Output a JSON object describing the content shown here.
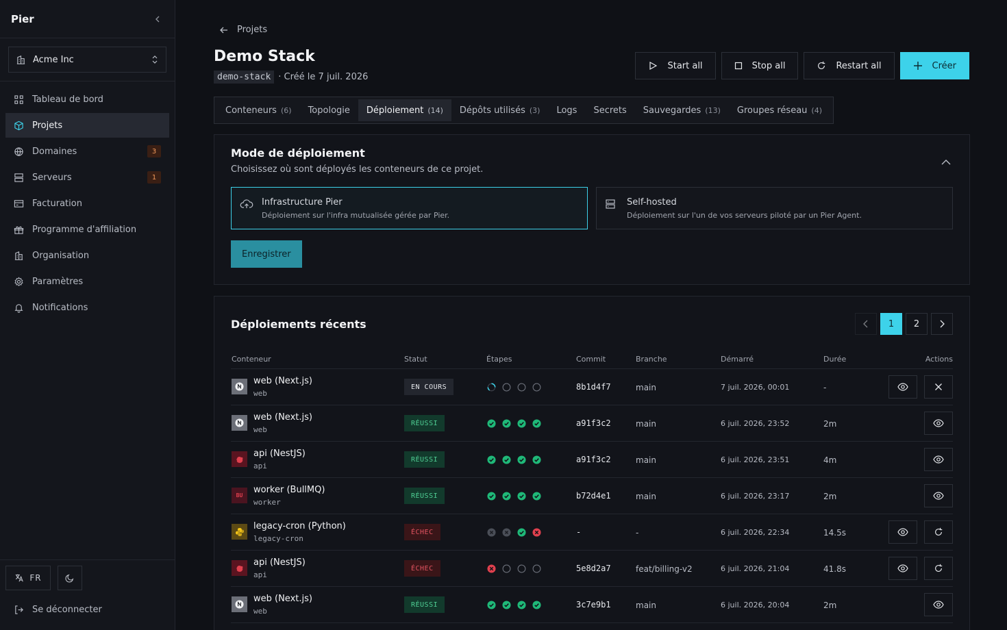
{
  "sidebar": {
    "brand": "Pier",
    "org": "Acme Inc",
    "items": [
      {
        "label": "Tableau de bord",
        "icon": "grid-icon",
        "badge": ""
      },
      {
        "label": "Projets",
        "icon": "cube-icon",
        "badge": "",
        "active": true
      },
      {
        "label": "Domaines",
        "icon": "globe-icon",
        "badge": "3"
      },
      {
        "label": "Serveurs",
        "icon": "server-icon",
        "badge": "1"
      },
      {
        "label": "Facturation",
        "icon": "credit-card-icon",
        "badge": ""
      },
      {
        "label": "Programme d'affiliation",
        "icon": "gift-icon",
        "badge": ""
      },
      {
        "label": "Organisation",
        "icon": "building-icon",
        "badge": ""
      },
      {
        "label": "Paramètres",
        "icon": "gear-icon",
        "badge": ""
      },
      {
        "label": "Notifications",
        "icon": "bell-icon",
        "badge": ""
      }
    ],
    "lang": "FR",
    "logout": "Se déconnecter"
  },
  "header": {
    "back": "Projets",
    "title": "Demo Stack",
    "slug": "demo-stack",
    "created": "· Créé le 7 juil. 2026",
    "actions": {
      "start": "Start all",
      "stop": "Stop all",
      "restart": "Restart all",
      "create": "Créer"
    }
  },
  "tabs": [
    {
      "label": "Conteneurs",
      "count": "(6)"
    },
    {
      "label": "Topologie",
      "count": ""
    },
    {
      "label": "Déploiement",
      "count": "(14)",
      "active": true
    },
    {
      "label": "Dépôts utilisés",
      "count": "(3)"
    },
    {
      "label": "Logs",
      "count": ""
    },
    {
      "label": "Secrets",
      "count": ""
    },
    {
      "label": "Sauvegardes",
      "count": "(13)"
    },
    {
      "label": "Groupes réseau",
      "count": "(4)"
    }
  ],
  "mode": {
    "title": "Mode de déploiement",
    "desc": "Choisissez où sont déployés les conteneurs de ce projet.",
    "options": [
      {
        "title": "Infrastructure Pier",
        "desc": "Déploiement sur l'infra mutualisée gérée par Pier."
      },
      {
        "title": "Self-hosted",
        "desc": "Déploiement sur l'un de vos serveurs piloté par un Pier Agent."
      }
    ],
    "save": "Enregistrer"
  },
  "recent": {
    "title": "Déploiements récents",
    "pages": [
      "1",
      "2"
    ],
    "columns": {
      "container": "Conteneur",
      "status": "Statut",
      "steps": "Étapes",
      "commit": "Commit",
      "branch": "Branche",
      "started": "Démarré",
      "duration": "Durée",
      "actions": "Actions"
    },
    "rows": [
      {
        "name": "web (Next.js)",
        "sub": "web",
        "kind": "next",
        "status": "EN COURS",
        "state": "run",
        "steps": [
          "spin",
          "empty",
          "empty",
          "empty"
        ],
        "commit": "8b1d4f7",
        "branch": "main",
        "started": "7 juil. 2026, 00:01",
        "duration": "-",
        "actions": [
          "view",
          "cancel"
        ]
      },
      {
        "name": "web (Next.js)",
        "sub": "web",
        "kind": "next",
        "status": "RÉUSSI",
        "state": "ok",
        "steps": [
          "ok",
          "ok",
          "ok",
          "ok"
        ],
        "commit": "a91f3c2",
        "branch": "main",
        "started": "6 juil. 2026, 23:52",
        "duration": "2m",
        "actions": [
          "view"
        ]
      },
      {
        "name": "api (NestJS)",
        "sub": "api",
        "kind": "nest",
        "status": "RÉUSSI",
        "state": "ok",
        "steps": [
          "ok",
          "ok",
          "ok",
          "ok"
        ],
        "commit": "a91f3c2",
        "branch": "main",
        "started": "6 juil. 2026, 23:51",
        "duration": "4m",
        "actions": [
          "view"
        ]
      },
      {
        "name": "worker (BullMQ)",
        "sub": "worker",
        "kind": "bull",
        "status": "RÉUSSI",
        "state": "ok",
        "steps": [
          "ok",
          "ok",
          "ok",
          "ok"
        ],
        "commit": "b72d4e1",
        "branch": "main",
        "started": "6 juil. 2026, 23:17",
        "duration": "2m",
        "actions": [
          "view"
        ]
      },
      {
        "name": "legacy-cron (Python)",
        "sub": "legacy-cron",
        "kind": "python",
        "status": "ÉCHEC",
        "state": "fail",
        "steps": [
          "skip",
          "skip",
          "ok",
          "fail"
        ],
        "commit": "-",
        "branch": "-",
        "started": "6 juil. 2026, 22:34",
        "duration": "14.5s",
        "actions": [
          "view",
          "retry"
        ]
      },
      {
        "name": "api (NestJS)",
        "sub": "api",
        "kind": "nest",
        "status": "ÉCHEC",
        "state": "fail",
        "steps": [
          "fail",
          "empty",
          "empty",
          "empty"
        ],
        "commit": "5e8d2a7",
        "branch": "feat/billing-v2",
        "started": "6 juil. 2026, 21:04",
        "duration": "41.8s",
        "actions": [
          "view",
          "retry"
        ]
      },
      {
        "name": "web (Next.js)",
        "sub": "web",
        "kind": "next",
        "status": "RÉUSSI",
        "state": "ok",
        "steps": [
          "ok",
          "ok",
          "ok",
          "ok"
        ],
        "commit": "3c7e9b1",
        "branch": "main",
        "started": "6 juil. 2026, 20:04",
        "duration": "2m",
        "actions": [
          "view"
        ]
      }
    ]
  },
  "colors": {
    "accent": "#3dd2ea",
    "success": "#1fb878",
    "danger": "#e0404e"
  }
}
